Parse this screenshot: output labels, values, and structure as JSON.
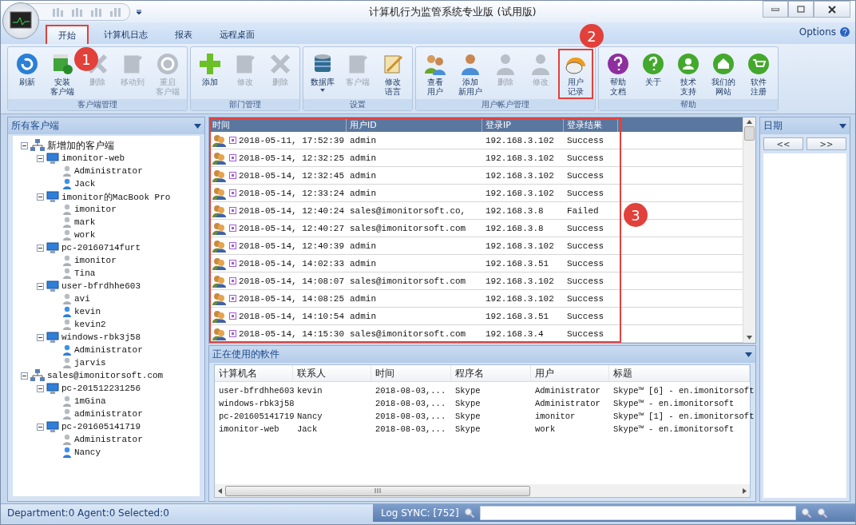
{
  "window": {
    "title": "计算机行为监管系统专业版 (试用版)"
  },
  "tabs": [
    {
      "label": "开始",
      "selected": true,
      "highlighted": true
    },
    {
      "label": "计算机日志",
      "selected": false,
      "highlighted": false
    },
    {
      "label": "报表",
      "selected": false,
      "highlighted": false
    },
    {
      "label": "远程桌面",
      "selected": false,
      "highlighted": false
    }
  ],
  "options": "Options",
  "ribbon": [
    {
      "label": "客户端管理",
      "buttons": [
        {
          "label": [
            "刷新"
          ],
          "disabled": false,
          "highlighted": false
        },
        {
          "label": [
            "安装",
            "客户端"
          ],
          "disabled": false,
          "highlighted": false
        },
        {
          "label": [
            "删除"
          ],
          "disabled": true,
          "highlighted": false
        },
        {
          "label": [
            "移动到"
          ],
          "disabled": true,
          "highlighted": false
        },
        {
          "label": [
            "重启",
            "客户端"
          ],
          "disabled": true,
          "highlighted": false
        }
      ]
    },
    {
      "label": "部门管理",
      "buttons": [
        {
          "label": [
            "添加"
          ],
          "disabled": false,
          "highlighted": false
        },
        {
          "label": [
            "修改"
          ],
          "disabled": true,
          "highlighted": false
        },
        {
          "label": [
            "删除"
          ],
          "disabled": true,
          "highlighted": false
        }
      ]
    },
    {
      "label": "设置",
      "buttons": [
        {
          "label": [
            "数据库"
          ],
          "disabled": false,
          "highlighted": false,
          "has_menu": true
        },
        {
          "label": [
            "客户端"
          ],
          "disabled": true,
          "highlighted": false
        },
        {
          "label": [
            "修改",
            "语言"
          ],
          "disabled": false,
          "highlighted": false
        }
      ]
    },
    {
      "label": "用户帐户管理",
      "buttons": [
        {
          "label": [
            "查看",
            "用户"
          ],
          "disabled": false,
          "highlighted": false
        },
        {
          "label": [
            "添加",
            "新用户"
          ],
          "disabled": false,
          "highlighted": false
        },
        {
          "label": [
            "删除"
          ],
          "disabled": true,
          "highlighted": false
        },
        {
          "label": [
            "修改"
          ],
          "disabled": true,
          "highlighted": false
        },
        {
          "label": [
            "用户",
            "记录"
          ],
          "disabled": false,
          "highlighted": true
        }
      ]
    },
    {
      "label": "帮助",
      "buttons": [
        {
          "label": [
            "帮助",
            "文档"
          ],
          "disabled": false,
          "highlighted": false
        },
        {
          "label": [
            "关于"
          ],
          "disabled": false,
          "highlighted": false
        },
        {
          "label": [
            "技术",
            "支持"
          ],
          "disabled": false,
          "highlighted": false
        },
        {
          "label": [
            "我们的",
            "网站"
          ],
          "disabled": false,
          "highlighted": false
        },
        {
          "label": [
            "软件",
            "注册"
          ],
          "disabled": false,
          "highlighted": false
        }
      ]
    }
  ],
  "clients_panel": {
    "title": "所有客户端",
    "tree": [
      {
        "label": "新增加的客户端",
        "kind": "group",
        "expanded": true,
        "children": [
          {
            "label": "imonitor-web",
            "kind": "computer",
            "expanded": true,
            "children": [
              {
                "label": "Administrator",
                "kind": "user",
                "active": false
              },
              {
                "label": "Jack",
                "kind": "user",
                "active": true
              }
            ]
          },
          {
            "label": "imonitor的MacBook Pro",
            "kind": "computer",
            "expanded": true,
            "children": [
              {
                "label": "imonitor",
                "kind": "user",
                "active": false
              },
              {
                "label": "mark",
                "kind": "user",
                "active": false
              },
              {
                "label": "work",
                "kind": "user",
                "active": false
              }
            ]
          },
          {
            "label": "pc-20160714furt",
            "kind": "computer",
            "expanded": true,
            "children": [
              {
                "label": "imonitor",
                "kind": "user",
                "active": false
              },
              {
                "label": "Tina",
                "kind": "user",
                "active": false
              }
            ]
          },
          {
            "label": "user-bfrdhhe603",
            "kind": "computer",
            "expanded": true,
            "children": [
              {
                "label": "avi",
                "kind": "user",
                "active": false
              },
              {
                "label": "kevin",
                "kind": "user",
                "active": true
              },
              {
                "label": "kevin2",
                "kind": "user",
                "active": false
              }
            ]
          },
          {
            "label": "windows-rbk3j58",
            "kind": "computer",
            "expanded": true,
            "children": [
              {
                "label": "Administrator",
                "kind": "user",
                "active": true
              },
              {
                "label": "jarvis",
                "kind": "user",
                "active": false
              }
            ]
          }
        ]
      },
      {
        "label": "sales@imonitorsoft.com",
        "kind": "group",
        "expanded": true,
        "children": [
          {
            "label": "pc-201512231256",
            "kind": "computer",
            "expanded": true,
            "children": [
              {
                "label": "1mGina",
                "kind": "user",
                "active": false
              },
              {
                "label": "administrator",
                "kind": "user",
                "active": false
              }
            ]
          },
          {
            "label": "pc-201605141719",
            "kind": "computer",
            "expanded": true,
            "children": [
              {
                "label": "Administrator",
                "kind": "user",
                "active": false
              },
              {
                "label": "Nancy",
                "kind": "user",
                "active": true
              }
            ]
          }
        ]
      }
    ]
  },
  "log_table": {
    "highlighted": true,
    "columns": [
      "时间",
      "用户ID",
      "登录IP",
      "登录结果"
    ],
    "rows": [
      [
        "2018-05-11, 17:52:39",
        "admin",
        "192.168.3.102",
        "Success"
      ],
      [
        "2018-05-14, 12:32:25",
        "admin",
        "192.168.3.102",
        "Success"
      ],
      [
        "2018-05-14, 12:32:45",
        "admin",
        "192.168.3.102",
        "Success"
      ],
      [
        "2018-05-14, 12:33:24",
        "admin",
        "192.168.3.102",
        "Success"
      ],
      [
        "2018-05-14, 12:40:24",
        "sales@imonitorsoft.co,",
        "192.168.3.8",
        "Failed"
      ],
      [
        "2018-05-14, 12:40:27",
        "sales@imonitorsoft.com",
        "192.168.3.8",
        "Success"
      ],
      [
        "2018-05-14, 12:40:39",
        "admin",
        "192.168.3.102",
        "Success"
      ],
      [
        "2018-05-14, 14:02:33",
        "admin",
        "192.168.3.51",
        "Success"
      ],
      [
        "2018-05-14, 14:08:07",
        "sales@imonitorsoft.com",
        "192.168.3.102",
        "Success"
      ],
      [
        "2018-05-14, 14:08:25",
        "admin",
        "192.168.3.102",
        "Success"
      ],
      [
        "2018-05-14, 14:10:54",
        "admin",
        "192.168.3.51",
        "Success"
      ],
      [
        "2018-05-14, 14:15:30",
        "sales@imonitorsoft.com",
        "192.168.3.4",
        "Success"
      ]
    ]
  },
  "software_panel": {
    "title": "正在使用的軟件",
    "columns": [
      "计算机名",
      "联系人",
      "时间",
      "程序名",
      "用户",
      "标题"
    ],
    "rows": [
      [
        "user-bfrdhhe603",
        "kevin",
        "2018-08-03,...",
        "Skype",
        "Administrator",
        "Skype™ [6] - en.imonitorsoft"
      ],
      [
        "windows-rbk3j58",
        "",
        "2018-08-03,...",
        "Skype",
        "Administrator",
        "Skype™ - en.imonitorsoft"
      ],
      [
        "pc-201605141719",
        "Nancy",
        "2018-08-03,...",
        "Skype",
        "imonitor",
        "Skype™ [1] - en.imonitorsoft"
      ],
      [
        "imonitor-web",
        "Jack",
        "2018-08-03,...",
        "Skype",
        "work",
        "Skype™ - en.imonitorsoft"
      ]
    ]
  },
  "date_panel": {
    "title": "日期",
    "buttons": [
      "<<",
      ">>"
    ]
  },
  "status_bar": {
    "counts": "Department:0  Agent:0  Selected:0",
    "sync": "Log SYNC: [752]"
  },
  "annotations": [
    {
      "label": "1"
    },
    {
      "label": "2"
    },
    {
      "label": "3"
    }
  ]
}
